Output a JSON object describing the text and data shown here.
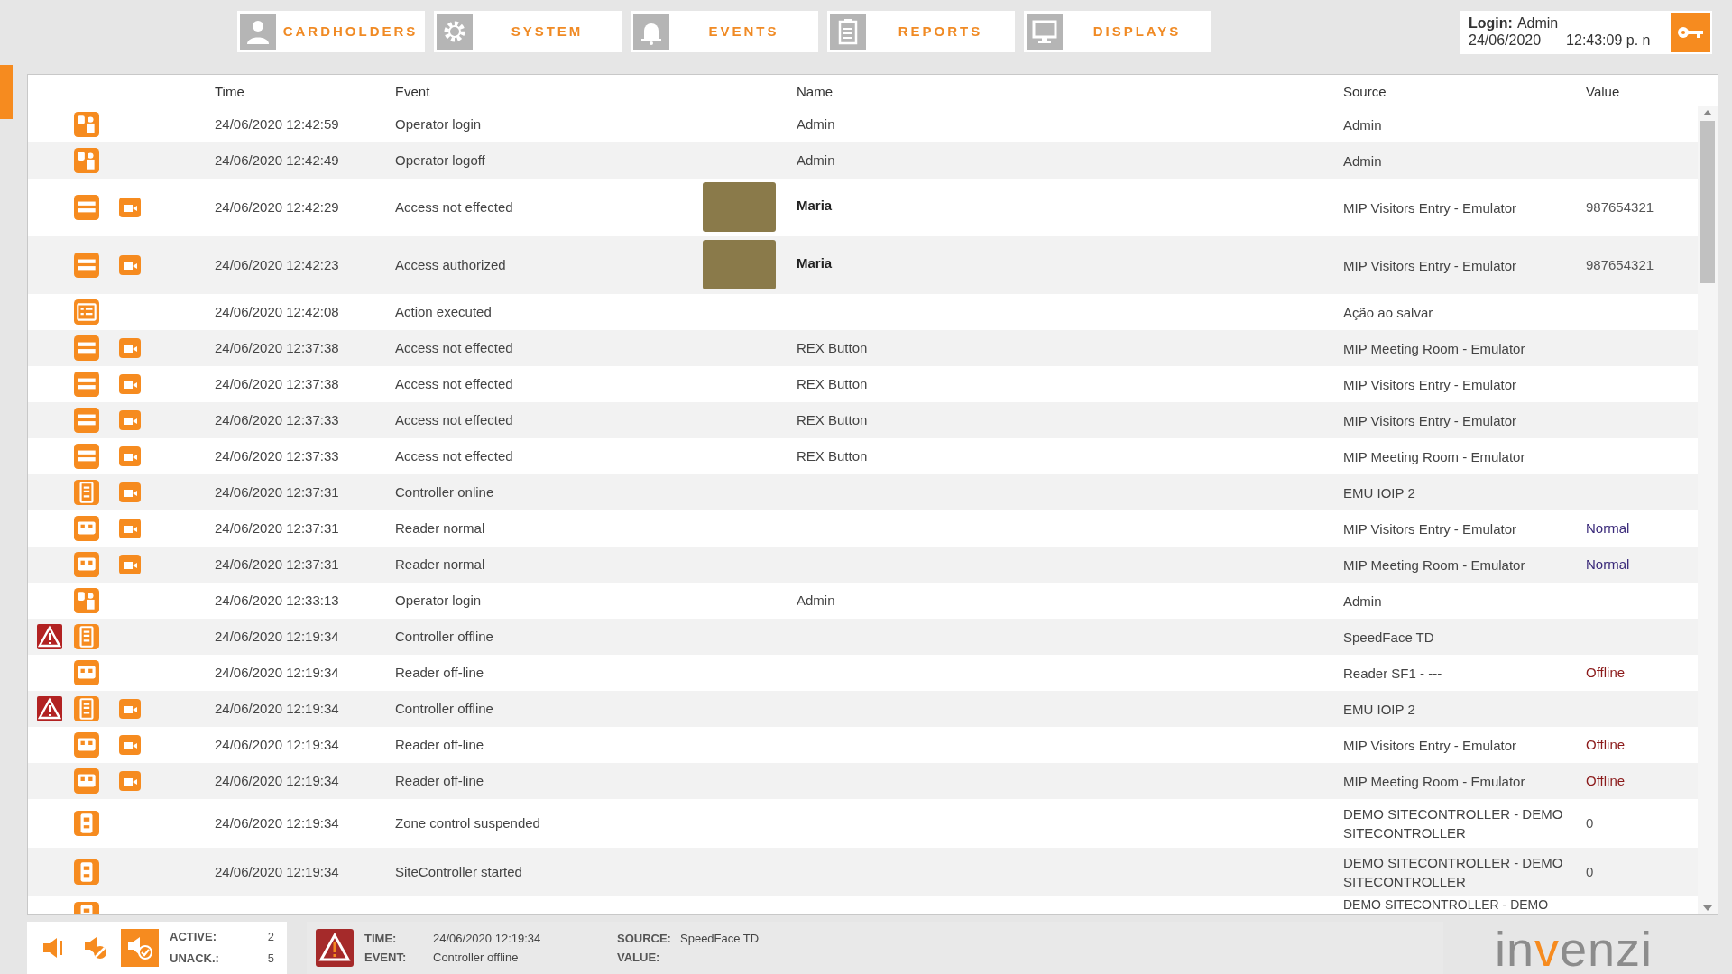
{
  "nav": [
    {
      "label": "CARDHOLDERS"
    },
    {
      "label": "SYSTEM"
    },
    {
      "label": "EVENTS"
    },
    {
      "label": "REPORTS"
    },
    {
      "label": "DISPLAYS"
    }
  ],
  "login": {
    "label": "Login:",
    "user": "Admin",
    "date": "24/06/2020",
    "time": "12:43:09 p. n"
  },
  "table": {
    "columns": [
      "Time",
      "Event",
      "Name",
      "Source",
      "Value"
    ],
    "rows": [
      {
        "alarm": false,
        "kind": "operator",
        "camera": false,
        "time": "24/06/2020 12:42:59",
        "event": "Operator login",
        "photo": false,
        "name": "Admin",
        "source": [
          "Admin"
        ]
      },
      {
        "alarm": false,
        "kind": "operator",
        "camera": false,
        "time": "24/06/2020 12:42:49",
        "event": "Operator logoff",
        "photo": false,
        "name": "Admin",
        "source": [
          "Admin"
        ]
      },
      {
        "alarm": false,
        "kind": "card",
        "camera": true,
        "time": "24/06/2020 12:42:29",
        "event": "Access not effected",
        "photo": true,
        "name": "Maria",
        "source": [
          "MIP Visitors Entry - Emulator"
        ],
        "value": {
          "text": "987654321",
          "color": "#555555"
        }
      },
      {
        "alarm": false,
        "kind": "card",
        "camera": true,
        "time": "24/06/2020 12:42:23",
        "event": "Access authorized",
        "photo": true,
        "name": "Maria",
        "source": [
          "MIP Visitors Entry - Emulator"
        ],
        "value": {
          "text": "987654321",
          "color": "#555555"
        }
      },
      {
        "alarm": false,
        "kind": "action",
        "camera": false,
        "time": "24/06/2020 12:42:08",
        "event": "Action executed",
        "photo": false,
        "source": [
          "Ação ao salvar"
        ]
      },
      {
        "alarm": false,
        "kind": "card",
        "camera": true,
        "time": "24/06/2020 12:37:38",
        "event": "Access not effected",
        "photo": false,
        "name": "REX Button",
        "source": [
          "MIP Meeting Room - Emulator"
        ]
      },
      {
        "alarm": false,
        "kind": "card",
        "camera": true,
        "time": "24/06/2020 12:37:38",
        "event": "Access not effected",
        "photo": false,
        "name": "REX Button",
        "source": [
          "MIP Visitors Entry - Emulator"
        ]
      },
      {
        "alarm": false,
        "kind": "card",
        "camera": true,
        "time": "24/06/2020 12:37:33",
        "event": "Access not effected",
        "photo": false,
        "name": "REX Button",
        "source": [
          "MIP Visitors Entry - Emulator"
        ]
      },
      {
        "alarm": false,
        "kind": "card",
        "camera": true,
        "time": "24/06/2020 12:37:33",
        "event": "Access not effected",
        "photo": false,
        "name": "REX Button",
        "source": [
          "MIP Meeting Room - Emulator"
        ]
      },
      {
        "alarm": false,
        "kind": "controller",
        "camera": true,
        "time": "24/06/2020 12:37:31",
        "event": "Controller online",
        "photo": false,
        "source": [
          "EMU IOIP 2"
        ]
      },
      {
        "alarm": false,
        "kind": "reader",
        "camera": true,
        "time": "24/06/2020 12:37:31",
        "event": "Reader normal",
        "photo": false,
        "source": [
          "MIP Visitors Entry - Emulator"
        ],
        "value": {
          "text": "Normal",
          "color": "#3a2a7a"
        }
      },
      {
        "alarm": false,
        "kind": "reader",
        "camera": true,
        "time": "24/06/2020 12:37:31",
        "event": "Reader normal",
        "photo": false,
        "source": [
          "MIP Meeting Room - Emulator"
        ],
        "value": {
          "text": "Normal",
          "color": "#3a2a7a"
        }
      },
      {
        "alarm": false,
        "kind": "operator",
        "camera": false,
        "time": "24/06/2020 12:33:13",
        "event": "Operator login",
        "photo": false,
        "name": "Admin",
        "source": [
          "Admin"
        ]
      },
      {
        "alarm": true,
        "kind": "controller",
        "camera": false,
        "time": "24/06/2020 12:19:34",
        "event": "Controller offline",
        "photo": false,
        "source": [
          "SpeedFace TD"
        ]
      },
      {
        "alarm": false,
        "kind": "reader",
        "camera": false,
        "time": "24/06/2020 12:19:34",
        "event": "Reader off-line",
        "photo": false,
        "source": [
          "Reader SF1 - ---"
        ],
        "value": {
          "text": "Offline",
          "color": "#8b1a1a"
        }
      },
      {
        "alarm": true,
        "kind": "controller",
        "camera": true,
        "time": "24/06/2020 12:19:34",
        "event": "Controller offline",
        "photo": false,
        "source": [
          "EMU IOIP 2"
        ]
      },
      {
        "alarm": false,
        "kind": "reader",
        "camera": true,
        "time": "24/06/2020 12:19:34",
        "event": "Reader off-line",
        "photo": false,
        "source": [
          "MIP Visitors Entry - Emulator"
        ],
        "value": {
          "text": "Offline",
          "color": "#8b1a1a"
        }
      },
      {
        "alarm": false,
        "kind": "reader",
        "camera": true,
        "time": "24/06/2020 12:19:34",
        "event": "Reader off-line",
        "photo": false,
        "source": [
          "MIP Meeting Room - Emulator"
        ],
        "value": {
          "text": "Offline",
          "color": "#8b1a1a"
        }
      },
      {
        "alarm": false,
        "kind": "zone",
        "camera": false,
        "time": "24/06/2020 12:19:34",
        "event": "Zone control suspended",
        "photo": false,
        "source": [
          "DEMO SITECONTROLLER - DEMO",
          "SITECONTROLLER"
        ],
        "value": {
          "text": "0",
          "color": "#555555"
        }
      },
      {
        "alarm": false,
        "kind": "zone",
        "camera": false,
        "time": "24/06/2020 12:19:34",
        "event": "SiteController started",
        "photo": false,
        "source": [
          "DEMO SITECONTROLLER - DEMO",
          "SITECONTROLLER"
        ],
        "value": {
          "text": "0",
          "color": "#555555"
        }
      },
      {
        "alarm": false,
        "kind": "zone",
        "camera": false,
        "photo": false,
        "source": [
          "DEMO SITECONTROLLER - DEMO"
        ]
      }
    ]
  },
  "counters": [
    {
      "label": "ACTIVE:",
      "value": "2"
    },
    {
      "label": "UNACK.:",
      "value": "5"
    }
  ],
  "last_event": {
    "fields": [
      {
        "label": "TIME:",
        "value": "24/06/2020 12:19:34"
      },
      {
        "label": "EVENT:",
        "value": "Controller offline"
      },
      {
        "label": "SOURCE:",
        "value": "SpeedFace TD"
      },
      {
        "label": "VALUE:"
      }
    ]
  },
  "logo": [
    {
      "text": "in",
      "accent": false
    },
    {
      "text": "v",
      "accent": true
    },
    {
      "text": "enzi",
      "accent": false
    }
  ]
}
